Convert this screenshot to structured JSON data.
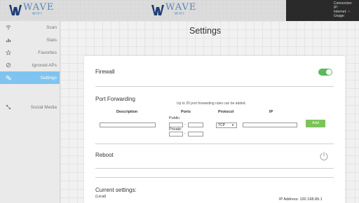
{
  "brand": {
    "logo_text": "WAVE",
    "logo_sub": "WIFI"
  },
  "status": {
    "connection_label": "Connection:",
    "ip_label": "IP:",
    "internet_label": "Internet:",
    "internet_value": "✕",
    "usage_label": "Usage:"
  },
  "sidebar": {
    "items": [
      {
        "label": "Scan",
        "icon": "wifi-icon"
      },
      {
        "label": "Stats",
        "icon": "bar-chart-icon"
      },
      {
        "label": "Favorites",
        "icon": "star-icon"
      },
      {
        "label": "Ignored APs",
        "icon": "ban-icon"
      },
      {
        "label": "Settings",
        "icon": "gears-icon",
        "active": true
      },
      {
        "label": "Social Media",
        "icon": "share-icon"
      }
    ]
  },
  "page": {
    "title": "Settings"
  },
  "firewall": {
    "title": "Firewall",
    "enabled": true,
    "toggle_color": "#5cb85c"
  },
  "port_forwarding": {
    "title": "Port Forwarding",
    "note": "Up to 20 port forwarding rules can be added.",
    "columns": [
      "Description",
      "Ports",
      "Protocol",
      "IP"
    ],
    "public_label": "Public:",
    "private_label": "Private:",
    "range_separator": "-",
    "protocol_value": "TCP",
    "add_label": "Add",
    "add_color": "#7dc35a"
  },
  "reboot": {
    "title": "Reboot"
  },
  "current": {
    "title": "Current settings:",
    "subtitle": "(Local)",
    "ip_address": "IP Address: 192.168.89.1"
  },
  "colors": {
    "accent": "#7fc4f0"
  }
}
